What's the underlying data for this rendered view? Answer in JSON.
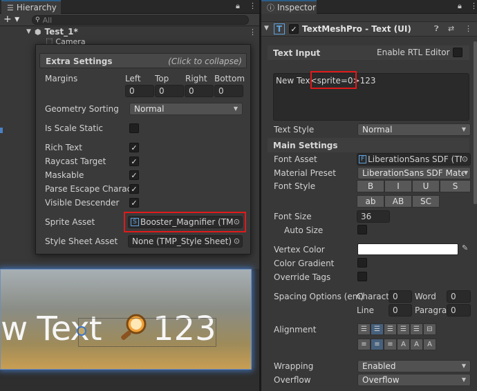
{
  "hierarchy": {
    "tab_label": "Hierarchy",
    "search_placeholder": "All",
    "add_label": "+ ▾",
    "item_test": "Test_1*",
    "item_camera": "Camera"
  },
  "extra_settings": {
    "title": "Extra Settings",
    "collapse_hint": "(Click to collapse)",
    "margins_label": "Margins",
    "margin_headers": [
      "Left",
      "Top",
      "Right",
      "Bottom"
    ],
    "margin_values": [
      "0",
      "0",
      "0",
      "0"
    ],
    "geometry_sorting_label": "Geometry Sorting",
    "geometry_sorting_value": "Normal",
    "is_scale_static_label": "Is Scale Static",
    "rich_text_label": "Rich Text",
    "raycast_target_label": "Raycast Target",
    "maskable_label": "Maskable",
    "parse_escape_label": "Parse Escape Charac",
    "visible_descender_label": "Visible Descender",
    "sprite_asset_label": "Sprite Asset",
    "sprite_asset_value": "Booster_Magnifier (TMP",
    "style_sheet_label": "Style Sheet Asset",
    "style_sheet_value": "None (TMP_Style Sheet)",
    "checks": {
      "is_scale_static": false,
      "rich_text": true,
      "raycast_target": true,
      "maskable": true,
      "parse_escape": true,
      "visible_descender": true
    }
  },
  "scene": {
    "text_left": "w Text",
    "text_right": "123"
  },
  "inspector": {
    "tab_label": "Inspector",
    "component_title": "TextMeshPro - Text (UI)",
    "text_input_label": "Text Input",
    "enable_rtl_label": "Enable RTL Editor",
    "text_prefix": "New Tex",
    "text_sprite": "<sprite=0>",
    "text_suffix": "123",
    "text_style_label": "Text Style",
    "text_style_value": "Normal",
    "main_settings_label": "Main Settings",
    "font_asset_label": "Font Asset",
    "font_asset_value": "LiberationSans SDF (TM",
    "material_preset_label": "Material Preset",
    "material_preset_value": "LiberationSans SDF Material",
    "font_style_label": "Font Style",
    "font_style_buttons": [
      "B",
      "I",
      "U",
      "S",
      "ab",
      "AB",
      "SC"
    ],
    "font_size_label": "Font Size",
    "font_size_value": "36",
    "auto_size_label": "Auto Size",
    "vertex_color_label": "Vertex Color",
    "vertex_color": "#ffffff",
    "color_gradient_label": "Color Gradient",
    "override_tags_label": "Override Tags",
    "spacing_label": "Spacing Options (em)",
    "spacing_character_label": "Charact",
    "spacing_character_value": "0",
    "spacing_word_label": "Word",
    "spacing_word_value": "0",
    "spacing_line_label": "Line",
    "spacing_line_value": "0",
    "spacing_paragraph_label": "Paragra",
    "spacing_paragraph_value": "0",
    "alignment_label": "Alignment",
    "wrapping_label": "Wrapping",
    "wrapping_value": "Enabled",
    "overflow_label": "Overflow",
    "overflow_value": "Overflow"
  },
  "colors": {
    "highlight": "#e01a1a",
    "accent": "#2c5d87"
  }
}
